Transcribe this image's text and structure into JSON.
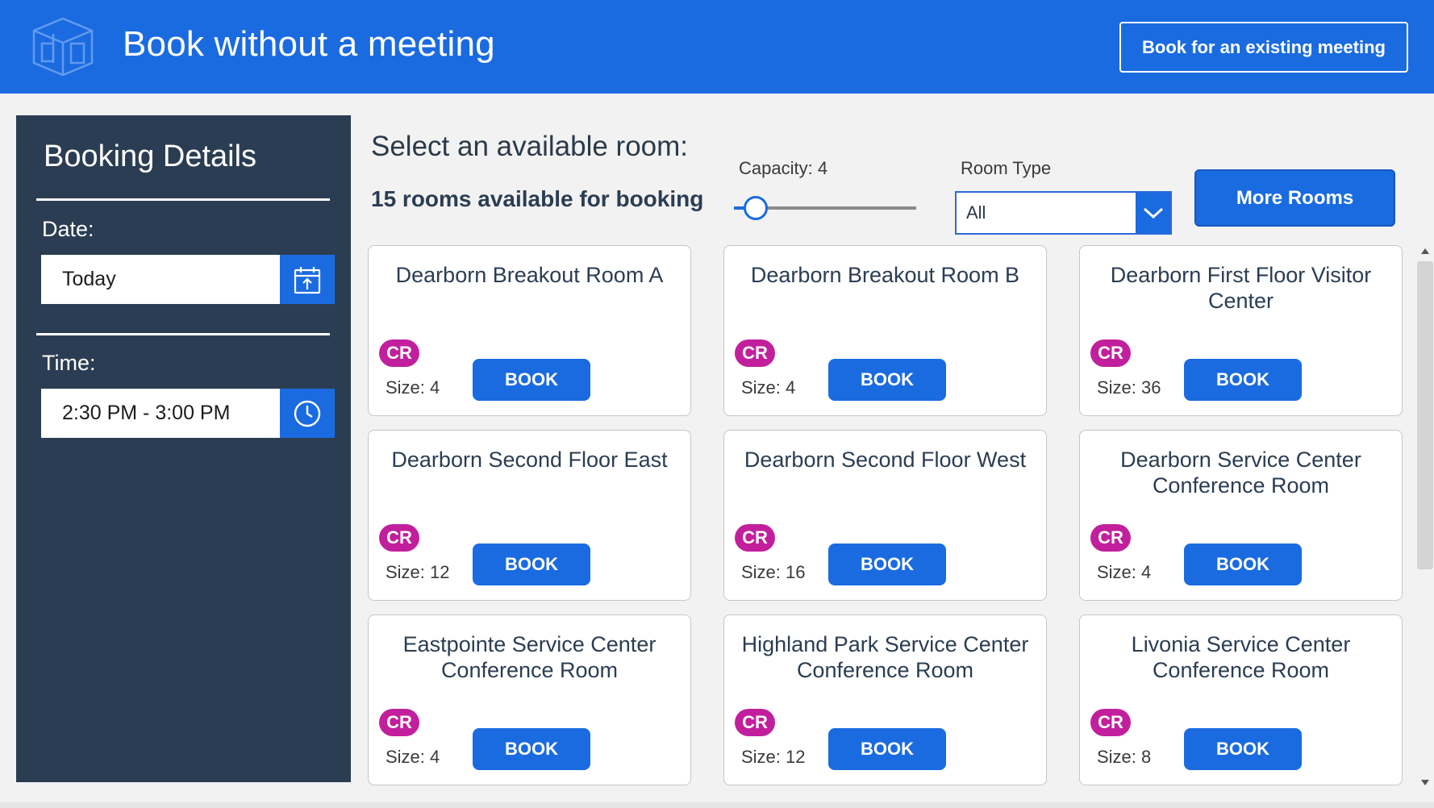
{
  "header": {
    "title": "Book without a meeting",
    "existing_meeting_label": "Book for an existing meeting",
    "background_color": "#1a6be0"
  },
  "sidebar": {
    "title": "Booking Details",
    "date_label": "Date:",
    "date_value": "Today",
    "date_icon": "calendar-icon",
    "time_label": "Time:",
    "time_value": "2:30 PM - 3:00 PM",
    "time_icon": "clock-icon",
    "background_color": "#2b3d53"
  },
  "main": {
    "title": "Select an available room:",
    "available_text": "15 rooms available for booking",
    "capacity_label": "Capacity: 4",
    "capacity_slider_fraction": 0.12,
    "room_type_label": "Room Type",
    "room_type_value": "All",
    "more_rooms_label": "More Rooms"
  },
  "rooms": [
    {
      "name": "Dearborn Breakout Room A",
      "badge": "CR",
      "size": "Size: 4",
      "book": "BOOK"
    },
    {
      "name": "Dearborn Breakout Room B",
      "badge": "CR",
      "size": "Size: 4",
      "book": "BOOK"
    },
    {
      "name": "Dearborn First Floor Visitor Center",
      "badge": "CR",
      "size": "Size: 36",
      "book": "BOOK"
    },
    {
      "name": "Dearborn Second Floor East",
      "badge": "CR",
      "size": "Size: 12",
      "book": "BOOK"
    },
    {
      "name": "Dearborn Second Floor West",
      "badge": "CR",
      "size": "Size: 16",
      "book": "BOOK"
    },
    {
      "name": "Dearborn Service Center Conference Room",
      "badge": "CR",
      "size": "Size: 4",
      "book": "BOOK"
    },
    {
      "name": "Eastpointe Service Center Conference Room",
      "badge": "CR",
      "size": "Size: 4",
      "book": "BOOK"
    },
    {
      "name": "Highland Park Service Center Conference Room",
      "badge": "CR",
      "size": "Size: 12",
      "book": "BOOK"
    },
    {
      "name": "Livonia Service Center Conference Room",
      "badge": "CR",
      "size": "Size: 8",
      "book": "BOOK"
    }
  ],
  "colors": {
    "accent": "#1a6be0",
    "badge": "#c21f9d",
    "sidebar": "#2b3d53"
  }
}
